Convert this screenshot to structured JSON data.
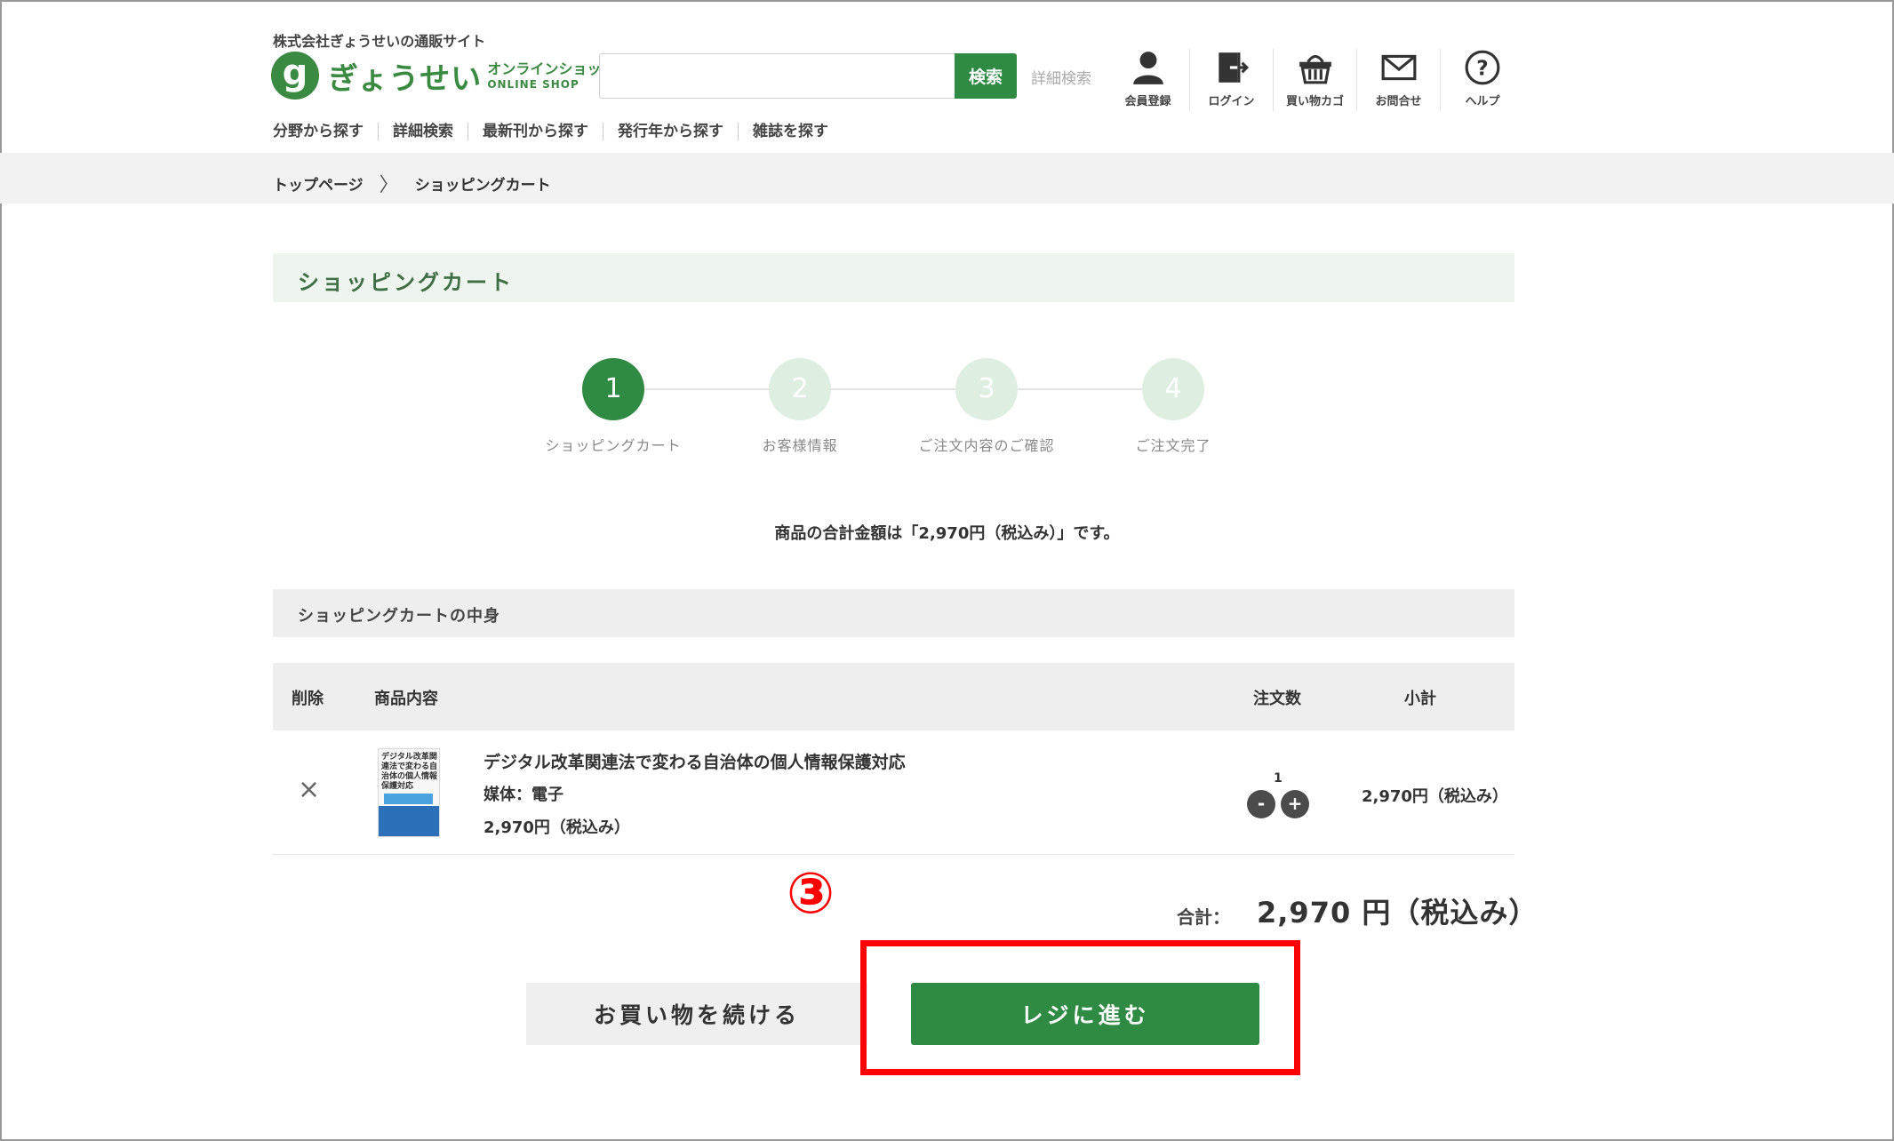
{
  "header": {
    "tagline": "株式会社ぎょうせいの通販サイト",
    "logo_mark": "g",
    "logo_text": "ぎょうせい",
    "logo_sub_a": "オンラインショップ",
    "logo_sub_b": "ONLINE SHOP",
    "search": {
      "placeholder": "",
      "button_label": "検索",
      "advanced_link": "詳細検索"
    },
    "icons": [
      {
        "name": "user-icon",
        "label": "会員登録"
      },
      {
        "name": "login-icon",
        "label": "ログイン"
      },
      {
        "name": "cart-icon",
        "label": "買い物カゴ"
      },
      {
        "name": "mail-icon",
        "label": "お問合せ"
      },
      {
        "name": "help-icon",
        "label": "ヘルプ"
      }
    ],
    "subnav": [
      "分野から探す",
      "詳細検索",
      "最新刊から探す",
      "発行年から探す",
      "雑誌を探す"
    ]
  },
  "breadcrumb": {
    "home": "トップページ",
    "separator": "〉",
    "current": "ショッピングカート"
  },
  "page_title": "ショッピングカート",
  "steps": [
    {
      "num": "1",
      "label": "ショッピングカート",
      "active": true
    },
    {
      "num": "2",
      "label": "お客様情報",
      "active": false
    },
    {
      "num": "3",
      "label": "ご注文内容のご確認",
      "active": false
    },
    {
      "num": "4",
      "label": "ご注文完了",
      "active": false
    }
  ],
  "total_message": "商品の合計金額は「2,970円（税込み）」です。",
  "cart": {
    "section_title": "ショッピングカートの中身",
    "columns": {
      "remove": "削除",
      "item": "商品内容",
      "qty": "注文数",
      "subtotal": "小計"
    },
    "items": [
      {
        "remove_icon": "×",
        "thumb_title": "デジタル改革関連法で変わる自治体の個人情報保護対応",
        "name": "デジタル改革関連法で変わる自治体の個人情報保護対応",
        "media": "媒体：電子",
        "price": "2,970円（税込み）",
        "qty": "1",
        "minus": "-",
        "plus": "+",
        "subtotal": "2,970円（税込み）"
      }
    ],
    "grand_label": "合計：",
    "grand_value": "2,970 円（税込み）"
  },
  "annotation": "③",
  "actions": {
    "continue_label": "お買い物を続ける",
    "checkout_label": "レジに進む"
  },
  "colors": {
    "brand": "#2f8a43",
    "annotation": "#ff0000"
  }
}
